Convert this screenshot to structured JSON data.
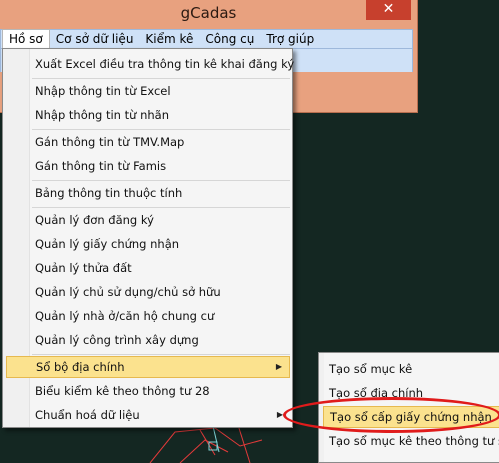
{
  "window": {
    "title": "gCadas",
    "close_glyph": "✕"
  },
  "menubar": {
    "items": [
      "Hồ sơ",
      "Cơ sở dữ liệu",
      "Kiểm kê",
      "Công cụ",
      "Trợ giúp"
    ]
  },
  "menu": {
    "items": [
      "Xuất Excel điều tra thông tin kê khai đăng ký",
      "Nhập thông tin từ Excel",
      "Nhập thông tin từ nhãn",
      "Gán thông tin từ TMV.Map",
      "Gán thông tin từ Famis",
      "Bảng thông tin thuộc tính",
      "Quản lý đơn đăng ký",
      "Quản lý giấy chứng nhận",
      "Quản lý thửa đất",
      "Quản lý chủ sử dụng/chủ sở hữu",
      "Quản lý nhà ở/căn hộ chung cư",
      "Quản lý công trình xây dựng",
      "Sổ bộ địa chính",
      "Biểu kiểm kê theo thông tư 28",
      "Chuẩn hoá dữ liệu"
    ],
    "submenu_arrow": "▶"
  },
  "submenu": {
    "items": [
      "Tạo sổ mục kê",
      "Tạo sổ địa chính",
      "Tạo sổ cấp giấy chứng nhận",
      "Tạo sổ mục kê theo thông tư số"
    ]
  },
  "colors": {
    "highlight": "#fbe28e",
    "annotation": "#e01b1b",
    "title_bar": "#e8a17f",
    "close_button": "#c7402d"
  }
}
